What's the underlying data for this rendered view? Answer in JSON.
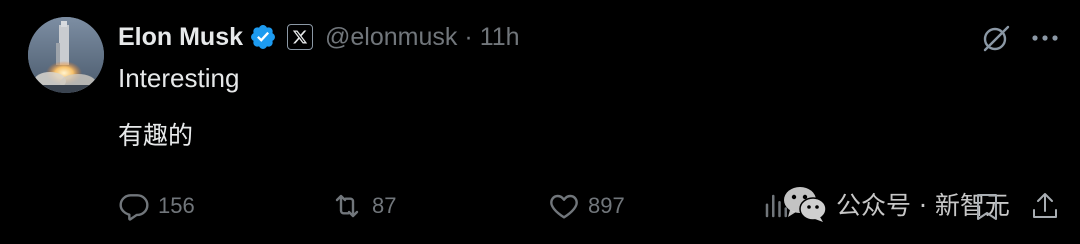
{
  "author": {
    "name": "Elon Musk",
    "handle": "@elonmusk",
    "separator": "·",
    "time": "11h",
    "verified_color": "#1d9bf0",
    "affiliation_badge": "x-logo-icon"
  },
  "tweet": {
    "lines": [
      "Interesting",
      "有趣的"
    ]
  },
  "actions": {
    "reply": {
      "icon": "reply-icon",
      "count": "156"
    },
    "retweet": {
      "icon": "retweet-icon",
      "count": "87"
    },
    "like": {
      "icon": "heart-icon",
      "count": "897"
    },
    "views": {
      "icon": "views-icon",
      "count": ""
    },
    "bookmark": {
      "icon": "bookmark-icon"
    },
    "share": {
      "icon": "share-icon"
    }
  },
  "watermark": {
    "icon": "wechat-icon",
    "text": "公众号 · 新智元"
  },
  "colors": {
    "background": "#000000",
    "primary_text": "#e7e9ea",
    "secondary_text": "#71767b"
  }
}
